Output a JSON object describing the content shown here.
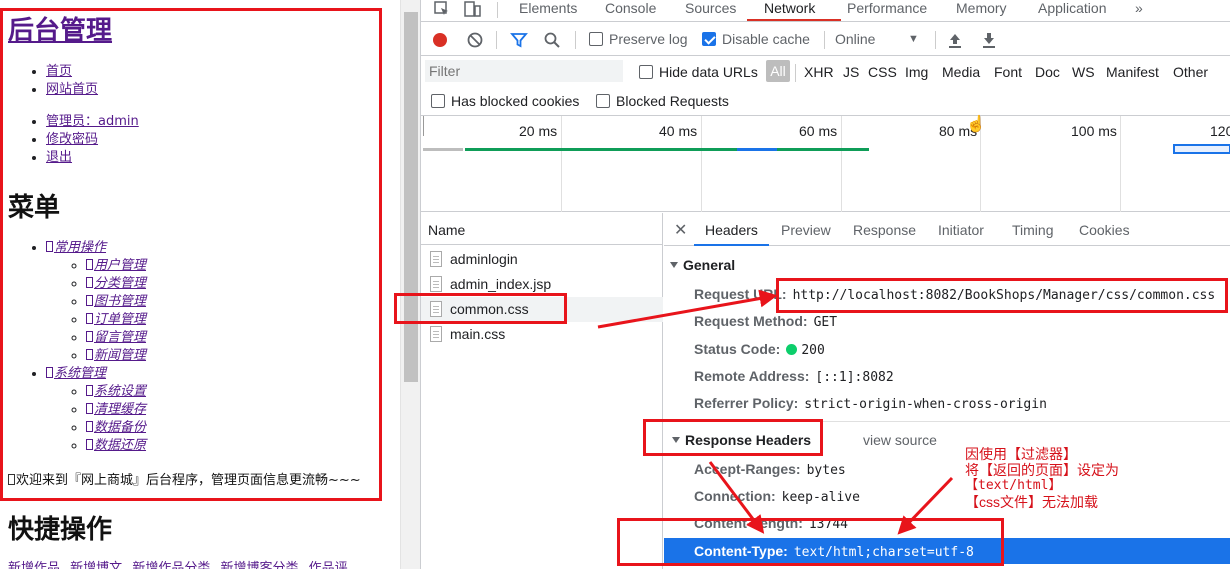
{
  "left_page": {
    "title": "后台管理",
    "nav_top": [
      "首页",
      "网站首页"
    ],
    "nav_user": [
      "管理员：admin",
      "修改密码",
      "退出"
    ],
    "menu_heading": "菜单",
    "menu": [
      {
        "label": "常用操作",
        "children": [
          "用户管理",
          "分类管理",
          "图书管理",
          "订单管理",
          "留言管理",
          "新闻管理"
        ]
      },
      {
        "label": "系统管理",
        "children": [
          "系统设置",
          "清理缓存",
          "数据备份",
          "数据还原"
        ]
      }
    ],
    "welcome": "欢迎来到『网上商城』后台程序，管理页面信息更流畅~~~",
    "quick_heading": "快捷操作",
    "quick_links": [
      "新增作品",
      "新增博文",
      "新增作品分类",
      "新增博客分类",
      "作品评"
    ]
  },
  "devtools": {
    "tabs": [
      "Elements",
      "Console",
      "Sources",
      "Network",
      "Performance",
      "Memory",
      "Application"
    ],
    "more_tabs": "»",
    "active_tab": "Network",
    "toolbar": {
      "preserve_log": "Preserve log",
      "preserve_log_checked": false,
      "disable_cache": "Disable cache",
      "disable_cache_checked": true,
      "throttling": "Online"
    },
    "filter": {
      "placeholder": "Filter",
      "hide_data_urls": "Hide data URLs",
      "types": [
        "All",
        "XHR",
        "JS",
        "CSS",
        "Img",
        "Media",
        "Font",
        "Doc",
        "WS",
        "Manifest",
        "Other"
      ],
      "active_type": "All",
      "has_blocked_cookies": "Has blocked cookies",
      "blocked_requests": "Blocked Requests"
    },
    "timeline": {
      "labels": [
        "20 ms",
        "40 ms",
        "60 ms",
        "80 ms",
        "100 ms",
        "120"
      ]
    },
    "requests": {
      "header": "Name",
      "items": [
        "adminlogin",
        "admin_index.jsp",
        "common.css",
        "main.css"
      ],
      "selected": "common.css"
    },
    "detail": {
      "tabs": [
        "Headers",
        "Preview",
        "Response",
        "Initiator",
        "Timing",
        "Cookies"
      ],
      "active_tab": "Headers",
      "general_title": "General",
      "general": [
        {
          "key": "Request URL:",
          "value": "http://localhost:8082/BookShops/Manager/css/common.css"
        },
        {
          "key": "Request Method:",
          "value": "GET"
        },
        {
          "key": "Status Code:",
          "value": "200"
        },
        {
          "key": "Remote Address:",
          "value": "[::1]:8082"
        },
        {
          "key": "Referrer Policy:",
          "value": "strict-origin-when-cross-origin"
        }
      ],
      "response_title": "Response Headers",
      "view_source": "view source",
      "response": [
        {
          "key": "Accept-Ranges:",
          "value": "bytes"
        },
        {
          "key": "Connection:",
          "value": "keep-alive"
        },
        {
          "key": "Content-Length:",
          "value": "13744"
        },
        {
          "key": "Content-Type:",
          "value": "text/html;charset=utf-8"
        }
      ]
    }
  },
  "annotation": {
    "lines": [
      "因使用【过滤器】",
      "将【返回的页面】设定为",
      "【text/html】",
      "【css文件】无法加载"
    ],
    "color": "#e8141b"
  }
}
